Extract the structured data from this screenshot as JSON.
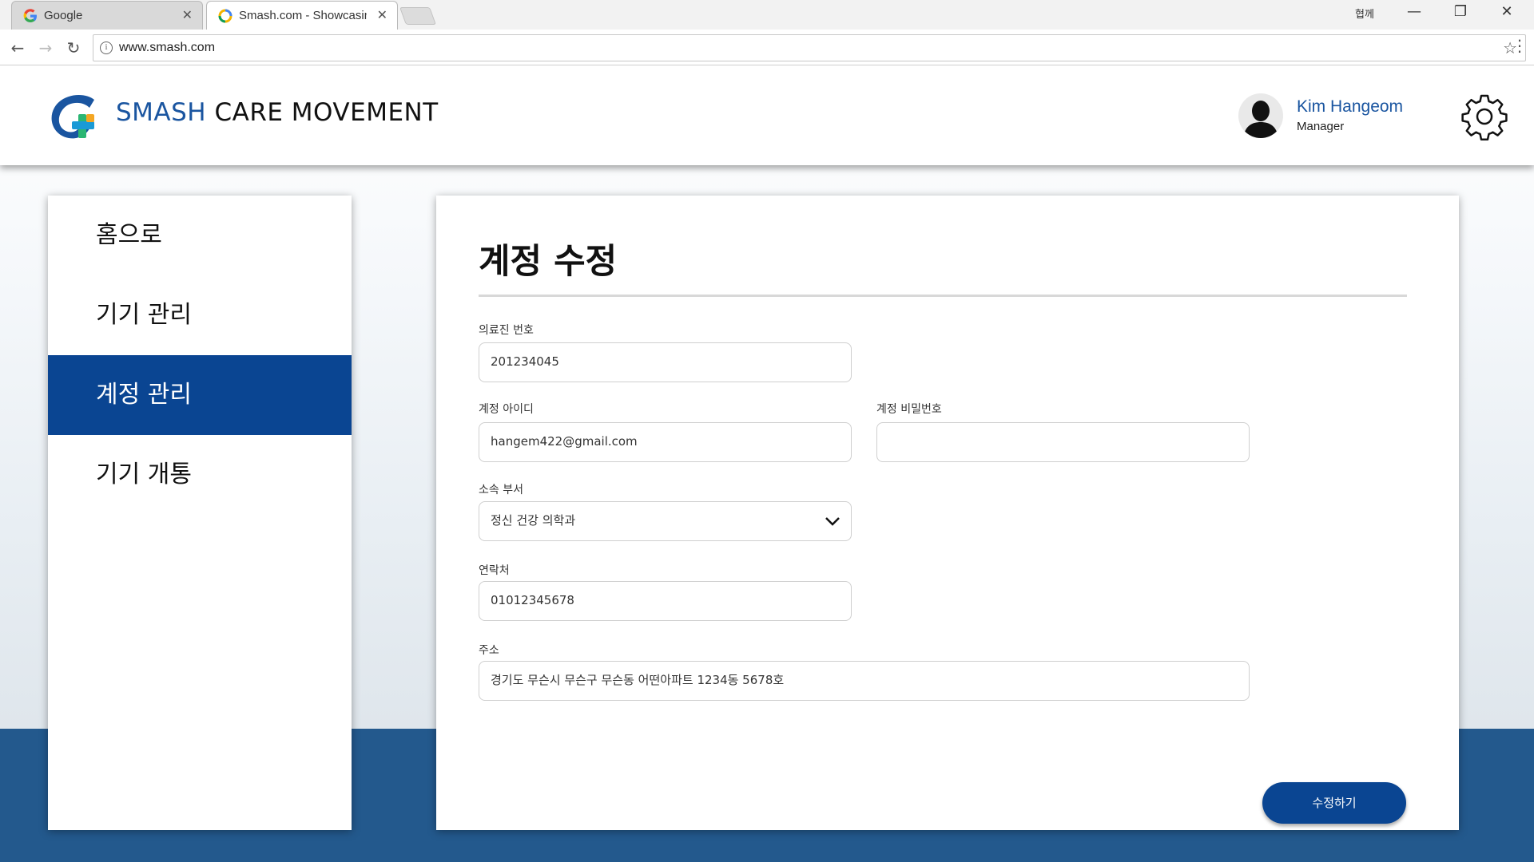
{
  "browser": {
    "tabs": [
      {
        "title": "Google",
        "icon": "google-icon"
      },
      {
        "title": "Smash.com - Showcasin",
        "icon": "chrome-loading-icon"
      }
    ],
    "window_user": "협께",
    "url": "www.smash.com"
  },
  "header": {
    "brand_part1": "SMASH",
    "brand_part2": " CARE MOVEMENT",
    "user_name": "Kim Hangeom",
    "user_role": "Manager"
  },
  "sidebar": {
    "items": [
      {
        "label": "홈으로"
      },
      {
        "label": "기기 관리"
      },
      {
        "label": "계정 관리",
        "active": true
      },
      {
        "label": "기기 개통"
      }
    ]
  },
  "form": {
    "title": "계정 수정",
    "medical_id_label": "의료진 번호",
    "medical_id_value": "201234045",
    "account_id_label": "계정 아이디",
    "account_id_value": "hangem422@gmail.com",
    "password_label": "계정 비밀번호",
    "password_value": "",
    "department_label": "소속 부서",
    "department_value": "정신 건강 의학과",
    "contact_label": "연락처",
    "contact_value": "01012345678",
    "address_label": "주소",
    "address_value": "경기도 무슨시 무슨구 무슨동 어떤아파트 1234동 5678호",
    "submit_label": "수정하기"
  },
  "colors": {
    "primary": "#0a4592",
    "brand_blue": "#1a55a0",
    "footer_band": "#23598d"
  }
}
